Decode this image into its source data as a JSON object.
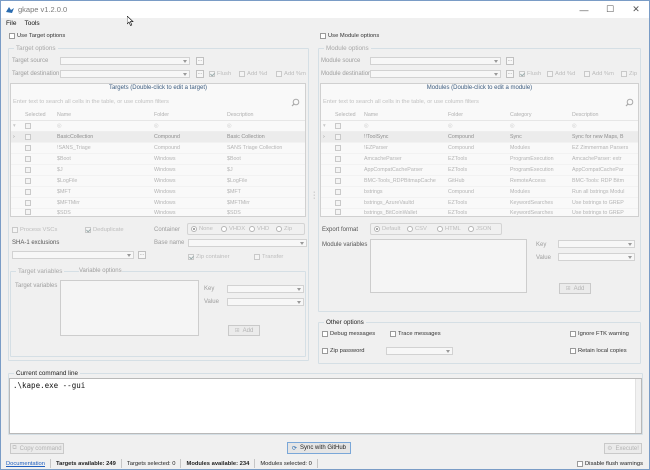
{
  "window": {
    "title": "gkape v1.2.0.0",
    "controls": [
      "—",
      "☐",
      "✕"
    ]
  },
  "menu": [
    "File",
    "Tools"
  ],
  "use_target": "Use Target options",
  "use_module": "Use Module options",
  "target": {
    "group_title": "Target options",
    "source_label": "Target source",
    "destination_label": "Target destination",
    "flush": "Flush",
    "add_pct_d": "Add %d",
    "add_pct_m": "Add %m",
    "grid_header": "Targets (Double-click to edit a target)",
    "search_placeholder": "Enter text to search all cells in the table, or use column filters",
    "columns": [
      "Selected",
      "Name",
      "Folder",
      "Description"
    ],
    "rows": [
      [
        "BasicCollection",
        "Compound",
        "Basic Collection"
      ],
      [
        "!SANS_Triage",
        "Compound",
        "SANS Triage Collection"
      ],
      [
        "$Boot",
        "Windows",
        "$Boot"
      ],
      [
        "$J",
        "Windows",
        "$J"
      ],
      [
        "$LogFile",
        "Windows",
        "$LogFile"
      ],
      [
        "$MFT",
        "Windows",
        "$MFT"
      ],
      [
        "$MFTMirr",
        "Windows",
        "$MFTMirr"
      ],
      [
        "$SDS",
        "Windows",
        "$SDS"
      ]
    ],
    "process_vscs": "Process VSCs",
    "deduplicate": "Deduplicate",
    "container_label": "Container",
    "container_opts": [
      "None",
      "VHDX",
      "VHD",
      "Zip"
    ],
    "sha1_label": "SHA-1 exclusions",
    "basename_label": "Base name",
    "zip_container": "Zip container",
    "transfer": "Transfer",
    "variables_group": "Target variables",
    "variables_link": "Variable options",
    "variables_label": "Target variables",
    "key_label": "Key",
    "value_label": "Value",
    "add_label": "Add"
  },
  "module": {
    "group_title": "Module options",
    "source_label": "Module source",
    "destination_label": "Module destination",
    "flush": "Flush",
    "add_pct_d": "Add %d",
    "add_pct_m": "Add %m",
    "zip": "Zip",
    "grid_header": "Modules (Double-click to edit a module)",
    "search_placeholder": "Enter text to search all cells in the table, or use column filters",
    "columns": [
      "Selected",
      "Name",
      "Folder",
      "Category",
      "Description"
    ],
    "rows": [
      [
        "!EZParser",
        "Compound",
        "Modules",
        "EZ Zimmerman Parsers"
      ],
      [
        "AmcacheParser",
        "EZTools",
        "ProgramExecution",
        "AmcacheParser: extr"
      ],
      [
        "AppCompatCacheParser",
        "EZTools",
        "ProgramExecution",
        "AppCompatCachePar"
      ],
      [
        "BMC-Tools_RDPBitmapCache",
        "GitHub",
        "RemoteAccess",
        "BMC-Tools: RDP Bitm"
      ],
      [
        "bstrings",
        "Compound",
        "Modules",
        "Run all bstrings Modul"
      ],
      [
        "bstrings_AzureVaultd",
        "EZTools",
        "KeywordSearches",
        "Use bstrings to GREP"
      ],
      [
        "bstrings_BitCoinWallet",
        "EZTools",
        "KeywordSearches",
        "Use bstrings to GREP"
      ]
    ],
    "first_row": [
      "!!ToolSync",
      "Compound",
      "Sync",
      "Sync for new Maps, B"
    ],
    "export_label": "Export format",
    "export_opts": [
      "Default",
      "CSV",
      "HTML",
      "JSON"
    ],
    "variables_label": "Module variables",
    "key_label": "Key",
    "value_label": "Value",
    "add_label": "Add"
  },
  "other": {
    "group_title": "Other options",
    "debug": "Debug messages",
    "trace": "Trace messages",
    "ignore_ftk": "Ignore FTK warning",
    "zip_password": "Zip password",
    "retain_local": "Retain local copies"
  },
  "cmdline": {
    "group_title": "Current command line",
    "text": ".\\kape.exe --gui"
  },
  "buttons": {
    "copy_command": "Copy command",
    "sync": "Sync with GitHub",
    "execute": "Execute!"
  },
  "status": {
    "documentation": "Documentation",
    "targets_available": "Targets available: 249",
    "targets_selected": "Targets selected: 0",
    "modules_available": "Modules available: 234",
    "modules_selected": "Modules selected: 0",
    "disable_flush": "Disable flush warnings"
  }
}
